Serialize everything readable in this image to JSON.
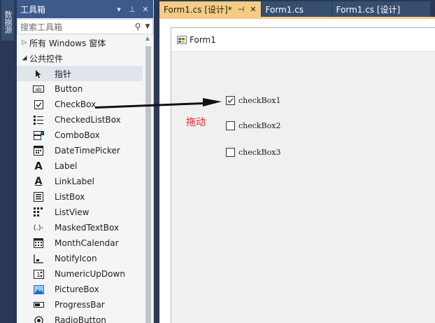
{
  "side_strip": {
    "label": "数据源"
  },
  "toolbox": {
    "title": "工具箱",
    "search_placeholder": "搜索工具箱",
    "groups": [
      {
        "label": "所有 Windows 窗体",
        "expanded": false
      },
      {
        "label": "公共控件",
        "expanded": true
      }
    ],
    "items": [
      {
        "label": "指针",
        "icon": "pointer-icon"
      },
      {
        "label": "Button",
        "icon": "button-icon"
      },
      {
        "label": "CheckBox",
        "icon": "checkbox-icon"
      },
      {
        "label": "CheckedListBox",
        "icon": "checkedlistbox-icon"
      },
      {
        "label": "ComboBox",
        "icon": "combobox-icon"
      },
      {
        "label": "DateTimePicker",
        "icon": "datetimepicker-icon"
      },
      {
        "label": "Label",
        "icon": "label-icon"
      },
      {
        "label": "LinkLabel",
        "icon": "linklabel-icon"
      },
      {
        "label": "ListBox",
        "icon": "listbox-icon"
      },
      {
        "label": "ListView",
        "icon": "listview-icon"
      },
      {
        "label": "MaskedTextBox",
        "icon": "maskedtextbox-icon"
      },
      {
        "label": "MonthCalendar",
        "icon": "monthcalendar-icon"
      },
      {
        "label": "NotifyIcon",
        "icon": "notifyicon-icon"
      },
      {
        "label": "NumericUpDown",
        "icon": "numericupdown-icon"
      },
      {
        "label": "PictureBox",
        "icon": "picturebox-icon"
      },
      {
        "label": "ProgressBar",
        "icon": "progressbar-icon"
      },
      {
        "label": "RadioButton",
        "icon": "radiobutton-icon"
      }
    ]
  },
  "tabs": [
    {
      "label": "Form1.cs [设计]*",
      "active": true
    },
    {
      "label": "Form1.cs",
      "active": false
    },
    {
      "label": "Form1.cs [设计]",
      "active": false
    }
  ],
  "form": {
    "title": "Form1",
    "checkboxes": [
      {
        "label": "checkBox1",
        "checked": true
      },
      {
        "label": "checkBox2",
        "checked": false
      },
      {
        "label": "checkBox3",
        "checked": false
      }
    ]
  },
  "annotation": {
    "label": "拖动",
    "color": "#e8292d"
  },
  "colors": {
    "titlebar": "#3c5a8c",
    "active_tab": "#f5cc84",
    "background": "#293955"
  }
}
